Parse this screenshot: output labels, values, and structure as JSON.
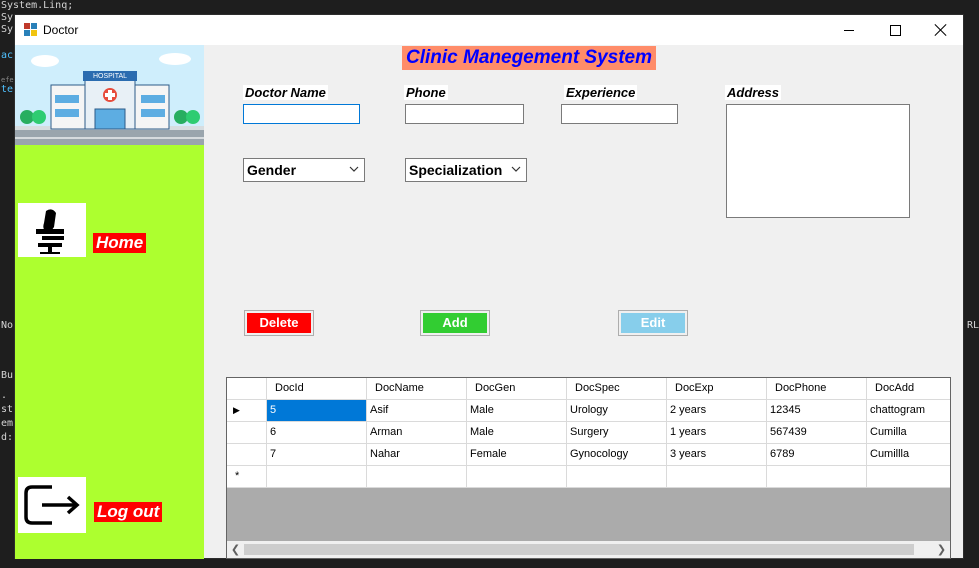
{
  "background": {
    "code_lines": [
      "System.Linq;",
      "Sy",
      "Sy",
      "ac",
      "efer",
      "te",
      "No",
      "Bu",
      ".",
      "st",
      "em",
      "d:"
    ],
    "right_text": [
      "RL"
    ]
  },
  "window": {
    "title": "Doctor"
  },
  "sidebar": {
    "hospital_sign": "HOSPITAL",
    "home_label": "Home",
    "logout_label": "Log out"
  },
  "form": {
    "app_title": "Clinic Manegement System",
    "doctor_name_label": "Doctor Name",
    "doctor_name_value": "",
    "phone_label": "Phone",
    "phone_value": "",
    "experience_label": "Experience",
    "experience_value": "",
    "address_label": "Address",
    "address_value": "",
    "gender_value": "Gender",
    "specialization_value": "Specialization",
    "delete_label": "Delete",
    "add_label": "Add",
    "edit_label": "Edit"
  },
  "colors": {
    "sidebar": "#adff2f",
    "delete": "#ff0000",
    "add": "#32cd32",
    "edit": "#87ceeb",
    "title_bg": "#ff8c69",
    "title_fg": "#0000ff"
  },
  "grid": {
    "columns": [
      "DocId",
      "DocName",
      "DocGen",
      "DocSpec",
      "DocExp",
      "DocPhone",
      "DocAdd"
    ],
    "rows": [
      [
        "5",
        "Asif",
        "Male",
        "Urology",
        "2 years",
        "12345",
        "chattogram"
      ],
      [
        "6",
        "Arman",
        "Male",
        "Surgery",
        "1 years",
        "567439",
        "Cumilla"
      ],
      [
        "7",
        "Nahar",
        "Female",
        "Gynocology",
        "3 years",
        "6789",
        "Cumillla"
      ]
    ],
    "new_row_marker": "*",
    "current_row_marker": "▶"
  }
}
